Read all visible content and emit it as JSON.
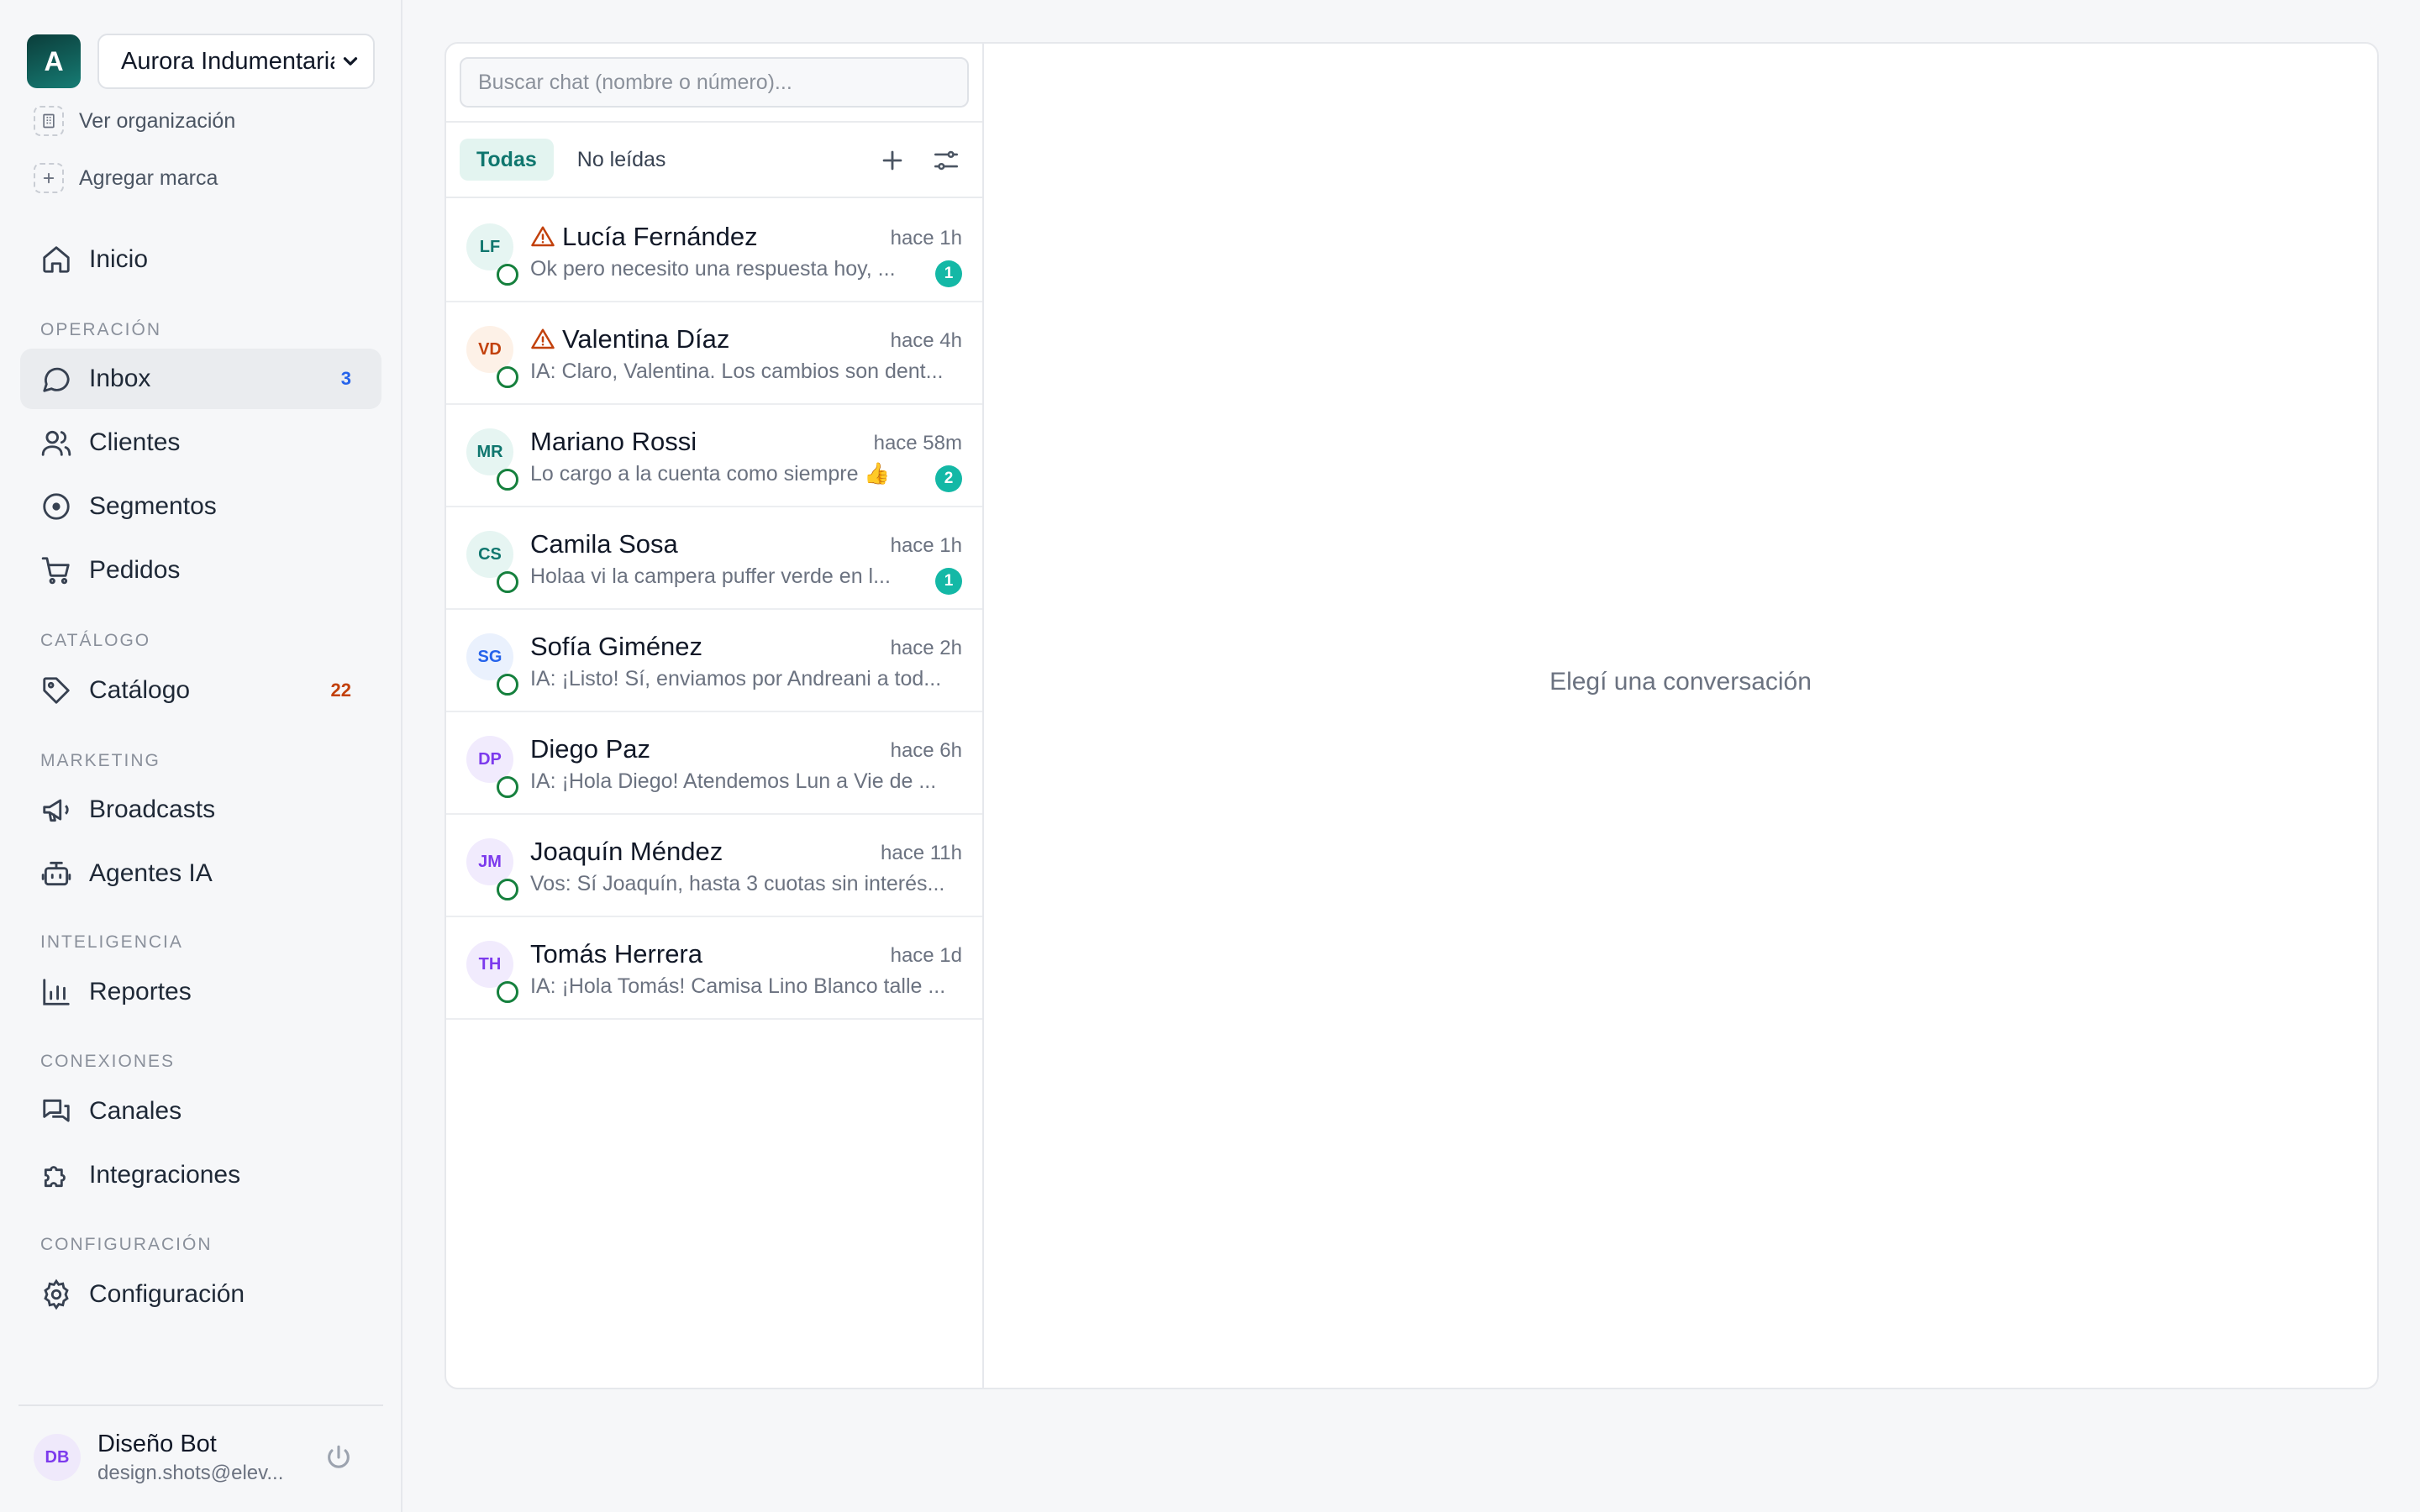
{
  "org": {
    "logo_letter": "A",
    "selected": "Aurora Indumentaria",
    "view_org": "Ver organización",
    "add_brand": "Agregar marca"
  },
  "nav": {
    "home": "Inicio",
    "sections": {
      "operacion": "OPERACIÓN",
      "catalogo": "CATÁLOGO",
      "marketing": "MARKETING",
      "inteligencia": "INTELIGENCIA",
      "conexiones": "CONEXIONES",
      "configuracion": "CONFIGURACIÓN"
    },
    "inbox": "Inbox",
    "inbox_count": "3",
    "clientes": "Clientes",
    "segmentos": "Segmentos",
    "pedidos": "Pedidos",
    "catalogo": "Catálogo",
    "catalogo_count": "22",
    "broadcasts": "Broadcasts",
    "agentes": "Agentes IA",
    "reportes": "Reportes",
    "canales": "Canales",
    "integraciones": "Integraciones",
    "configuracion": "Configuración"
  },
  "user": {
    "initials": "DB",
    "name": "Diseño Bot",
    "email": "design.shots@elev..."
  },
  "chat": {
    "search_placeholder": "Buscar chat (nombre o número)...",
    "tab_all": "Todas",
    "tab_unread": "No leídas",
    "empty": "Elegí una conversación",
    "conversations": [
      {
        "initials": "LF",
        "name": "Lucía Fernández",
        "time": "hace 1h",
        "preview": "Ok pero necesito una respuesta hoy, ...",
        "unread": "1",
        "warning": true,
        "color": "#0f766e",
        "bg": "#e6f5f2"
      },
      {
        "initials": "VD",
        "name": "Valentina Díaz",
        "time": "hace 4h",
        "preview": "IA: Claro, Valentina. Los cambios son dent...",
        "unread": "",
        "warning": true,
        "color": "#c2410c",
        "bg": "#fdf1e7"
      },
      {
        "initials": "MR",
        "name": "Mariano Rossi",
        "time": "hace 58m",
        "preview": "Lo cargo a la cuenta como siempre 👍",
        "unread": "2",
        "warning": false,
        "color": "#0f766e",
        "bg": "#e6f5f2"
      },
      {
        "initials": "CS",
        "name": "Camila Sosa",
        "time": "hace 1h",
        "preview": "Holaa vi la campera puffer verde en l...",
        "unread": "1",
        "warning": false,
        "color": "#0f766e",
        "bg": "#e6f5f2"
      },
      {
        "initials": "SG",
        "name": "Sofía Giménez",
        "time": "hace 2h",
        "preview": "IA: ¡Listo! Sí, enviamos por Andreani a tod...",
        "unread": "",
        "warning": false,
        "color": "#2563eb",
        "bg": "#eaf1fd"
      },
      {
        "initials": "DP",
        "name": "Diego Paz",
        "time": "hace 6h",
        "preview": "IA: ¡Hola Diego! Atendemos Lun a Vie de ...",
        "unread": "",
        "warning": false,
        "color": "#7c3aed",
        "bg": "#f1ebfd"
      },
      {
        "initials": "JM",
        "name": "Joaquín Méndez",
        "time": "hace 11h",
        "preview": "Vos: Sí Joaquín, hasta 3 cuotas sin interés...",
        "unread": "",
        "warning": false,
        "color": "#7c3aed",
        "bg": "#f1ebfd"
      },
      {
        "initials": "TH",
        "name": "Tomás Herrera",
        "time": "hace 1d",
        "preview": "IA: ¡Hola Tomás! Camisa Lino Blanco talle ...",
        "unread": "",
        "warning": false,
        "color": "#7c3aed",
        "bg": "#f1ebfd"
      }
    ]
  },
  "icons": {
    "inicio": "home-icon",
    "inbox": "chat-bubble-icon",
    "clientes": "users-icon",
    "segmentos": "target-icon",
    "pedidos": "cart-icon",
    "catalogo": "tag-icon",
    "broadcasts": "megaphone-icon",
    "agentes": "bot-icon",
    "reportes": "bar-chart-icon",
    "canales": "messages-icon",
    "integraciones": "puzzle-icon",
    "configuracion": "gear-icon"
  }
}
